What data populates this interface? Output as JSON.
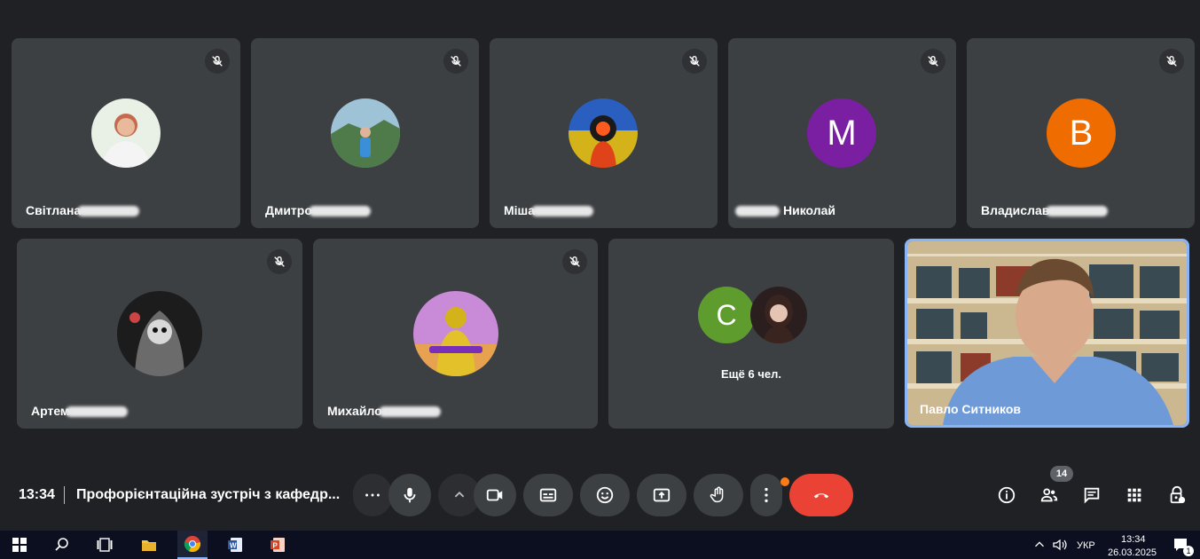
{
  "participants_row1": [
    {
      "name": "Світлана",
      "avatar": "photo-woman",
      "muted": true
    },
    {
      "name": "Дмитро",
      "avatar": "photo-mountain",
      "muted": true
    },
    {
      "name": "Міша",
      "avatar": "photo-neon",
      "muted": true
    },
    {
      "name": "Николай",
      "avatar_letter": "M",
      "avatar_color": "#7b1fa2",
      "muted": true
    },
    {
      "name": "Владислав",
      "avatar_letter": "B",
      "avatar_color": "#ef6c00",
      "muted": true
    }
  ],
  "participants_row2": [
    {
      "name": "Артем",
      "avatar": "photo-skull",
      "muted": true
    },
    {
      "name": "Михайло",
      "avatar": "photo-gamer",
      "muted": true
    }
  ],
  "others_tile": {
    "avatar_letter": "C",
    "avatar_color": "#5e9c2e",
    "label": "Ещё 6 чел."
  },
  "self_tile": {
    "name": "Павло Ситников"
  },
  "meeting": {
    "time": "13:34",
    "title": "Профорієнтаційна зустріч з кафедр..."
  },
  "controls": [
    "more-options",
    "microphone",
    "camera-options",
    "camera",
    "captions",
    "emoji",
    "present",
    "raise-hand",
    "more",
    "leave-call"
  ],
  "right_controls": {
    "participants_count": "14"
  },
  "taskbar": {
    "language": "УКР",
    "time": "13:34",
    "date": "26.03.2025",
    "notifications": "1"
  },
  "colors": {
    "background": "#202124",
    "tile": "#3c4043",
    "leave": "#ea4335",
    "self_border": "#8ab4f8"
  }
}
